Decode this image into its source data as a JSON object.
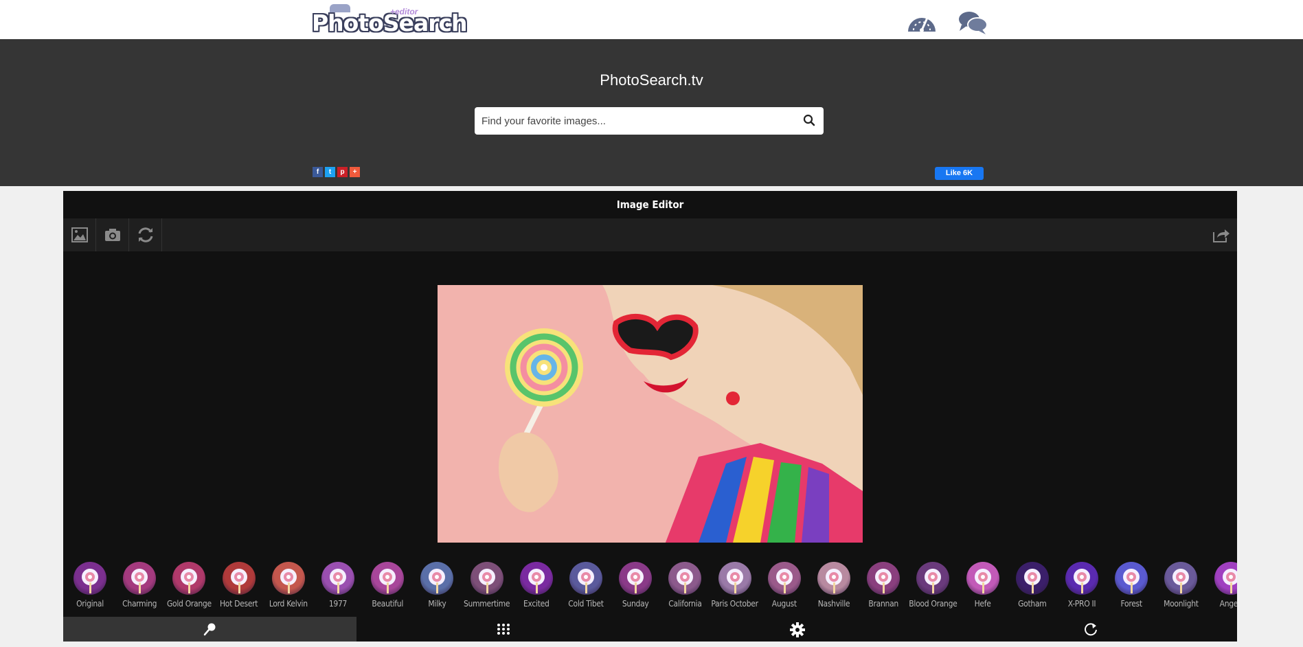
{
  "header": {
    "logo_text": "PhotoSearch",
    "logo_badge": "+editor",
    "icons": [
      "speedometer-icon",
      "chat-bubbles-icon"
    ]
  },
  "hero": {
    "title": "PhotoSearch.tv",
    "search_placeholder": "Find your favorite images...",
    "share_buttons": [
      "f",
      "t",
      "p",
      "+"
    ],
    "like_label": "Like 6K"
  },
  "editor": {
    "title": "Image Editor",
    "toolbar_icons": [
      "image-icon",
      "camera-icon",
      "refresh-icon",
      "share-out-icon"
    ],
    "filters": [
      {
        "label": "Original",
        "color": "#7b2f8f"
      },
      {
        "label": "Charming",
        "color": "#a43a7e"
      },
      {
        "label": "Gold Orange",
        "color": "#b0396a"
      },
      {
        "label": "Hot Desert",
        "color": "#b03a3a"
      },
      {
        "label": "Lord Kelvin",
        "color": "#c4574d"
      },
      {
        "label": "1977",
        "color": "#9a4fb0"
      },
      {
        "label": "Beautiful",
        "color": "#a8469a"
      },
      {
        "label": "Milky",
        "color": "#5a6fa8"
      },
      {
        "label": "Summertime",
        "color": "#7d4f78"
      },
      {
        "label": "Excited",
        "color": "#7a2aa0"
      },
      {
        "label": "Cold Tibet",
        "color": "#5a5a9c"
      },
      {
        "label": "Sunday",
        "color": "#8a3a88"
      },
      {
        "label": "California",
        "color": "#8c5a8c"
      },
      {
        "label": "Paris October",
        "color": "#9a7aa8"
      },
      {
        "label": "August",
        "color": "#9a5a8a"
      },
      {
        "label": "Nashville",
        "color": "#b88aa0"
      },
      {
        "label": "Brannan",
        "color": "#8a3f7e"
      },
      {
        "label": "Blood Orange",
        "color": "#6a3a7c"
      },
      {
        "label": "Hefe",
        "color": "#c25ab8"
      },
      {
        "label": "Gotham",
        "color": "#3b1f6a"
      },
      {
        "label": "X-PRO II",
        "color": "#5a2ab0"
      },
      {
        "label": "Forest",
        "color": "#5a5ad0"
      },
      {
        "label": "Moonlight",
        "color": "#6a5a9a"
      },
      {
        "label": "Angeli",
        "color": "#a040c0"
      }
    ],
    "bottom_nav": [
      "magnifier-icon",
      "grid-icon",
      "gear-icon",
      "reset-icon"
    ]
  },
  "colors": {
    "hero_bg": "#353535",
    "editor_bg": "#111111",
    "accent_fb": "#1877f2"
  }
}
